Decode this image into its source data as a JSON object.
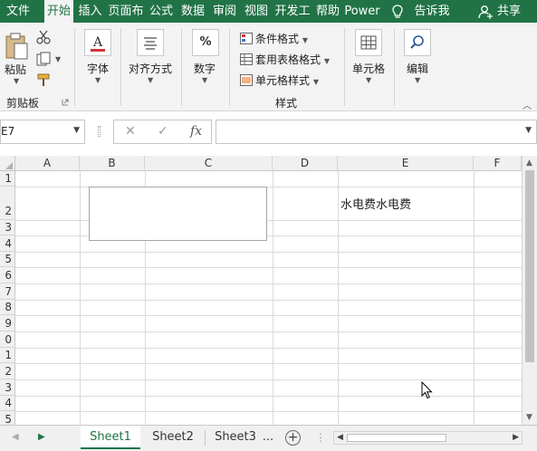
{
  "ribbon_tabs": [
    {
      "label": "文件"
    },
    {
      "label": "开始"
    },
    {
      "label": "插入"
    },
    {
      "label": "页面布"
    },
    {
      "label": "公式"
    },
    {
      "label": "数据"
    },
    {
      "label": "审阅"
    },
    {
      "label": "视图"
    },
    {
      "label": "开发工"
    },
    {
      "label": "帮助"
    },
    {
      "label": "Power"
    }
  ],
  "tell_me": {
    "label": "告诉我",
    "icon": "lightbulb-icon"
  },
  "share": {
    "label": "共享",
    "icon": "person-add-icon"
  },
  "ribbon": {
    "clipboard": {
      "paste": "粘贴",
      "group": "剪贴板"
    },
    "font": {
      "label": "字体"
    },
    "alignment": {
      "label": "对齐方式"
    },
    "number": {
      "label": "数字",
      "icon_text": "%"
    },
    "styles": {
      "conditional": "条件格式",
      "table": "套用表格格式",
      "cell_styles": "单元格样式",
      "group": "样式"
    },
    "cells": {
      "label": "单元格"
    },
    "editing": {
      "label": "编辑"
    }
  },
  "formula_bar": {
    "name_box": "E7",
    "cancel": "✕",
    "enter": "✓",
    "fx": "fx",
    "value": ""
  },
  "columns": [
    "A",
    "B",
    "C",
    "D",
    "E",
    "F"
  ],
  "rows": [
    "1",
    "2",
    "3",
    "4",
    "5",
    "6",
    "7",
    "8",
    "9",
    "0",
    "1",
    "2",
    "3",
    "4",
    "5"
  ],
  "cells": {
    "E2": "水电费水电费"
  },
  "sheet_tabs": [
    {
      "label": "Sheet1",
      "active": true
    },
    {
      "label": "Sheet2",
      "active": false
    },
    {
      "label": "Sheet3",
      "active": false
    }
  ],
  "more_sheets": "...",
  "add_sheet": "+",
  "colors": {
    "accent": "#217346",
    "ribbon_bg": "#f3f3f3",
    "header_bg": "#f0f0f0",
    "grid_line": "#dadada"
  }
}
